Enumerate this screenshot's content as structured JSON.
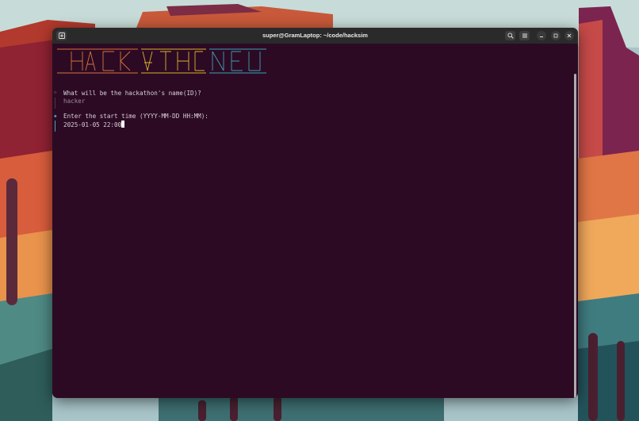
{
  "window": {
    "title": "super@GramLaptop: ~/code/hacksim"
  },
  "prompts": [
    {
      "question": "What will be the hackathon's name(ID)?",
      "answer": "hacker",
      "state": "answered",
      "marker_color": "#5b4a55"
    },
    {
      "question": "Enter the start time (YYYY-MM-DD HH:MM):",
      "answer": "2025-01-05 22:00",
      "state": "active",
      "marker_color": "#4aa3b8"
    }
  ],
  "icons": {
    "new_tab": "new-tab-icon",
    "search": "search-icon",
    "menu": "hamburger-menu-icon",
    "minimize": "minimize-icon",
    "maximize": "maximize-icon",
    "close": "close-icon"
  },
  "colors": {
    "terminal_bg": "#2c0a24",
    "titlebar_bg": "#2a2a2a",
    "banner_orange": "#d9743a",
    "banner_yellow": "#d8b22d",
    "banner_cyan": "#3ea3b5",
    "accent_cyan": "#4aa3b8"
  }
}
